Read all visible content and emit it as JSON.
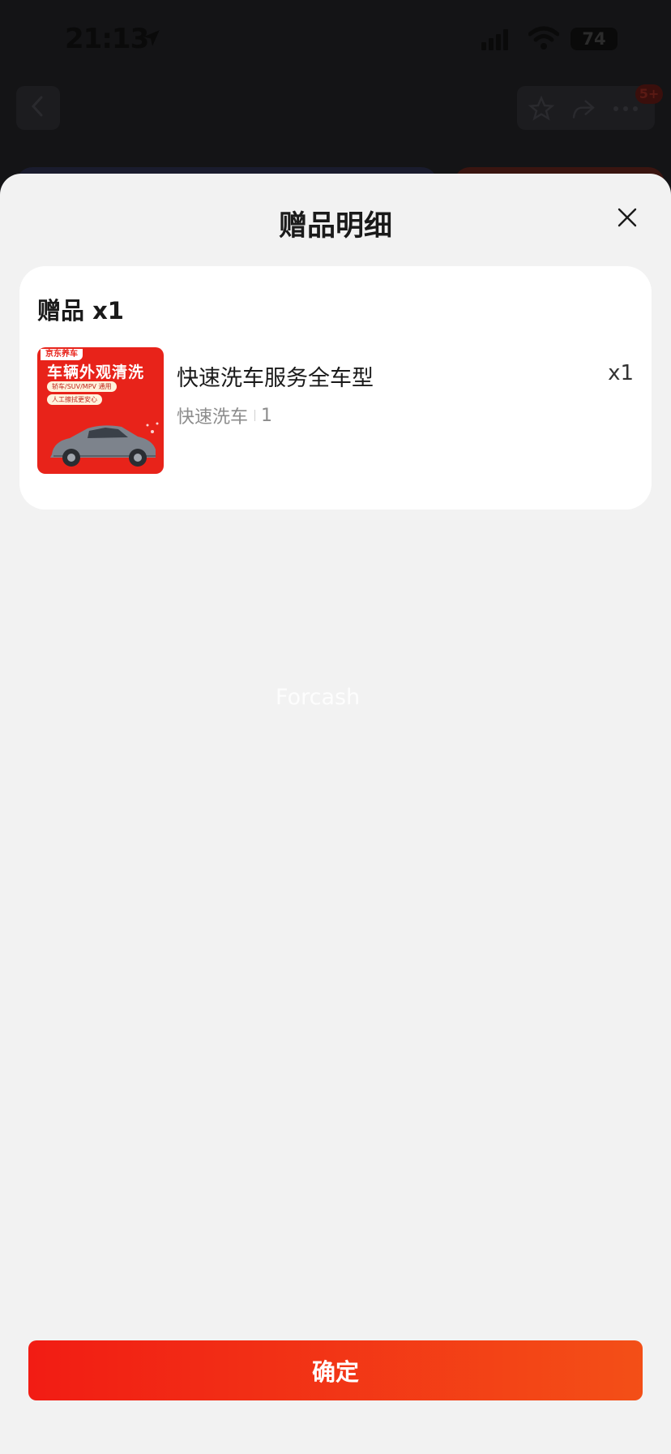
{
  "status_bar": {
    "time": "21:13",
    "battery": "74",
    "location_icon": "location-arrow-icon",
    "signal_icon": "cellular-signal-icon",
    "wifi_icon": "wifi-icon"
  },
  "background_nav": {
    "back_icon": "chevron-left-icon",
    "favorite_icon": "star-icon",
    "share_icon": "share-icon",
    "more_icon": "more-icon",
    "badge": "5+"
  },
  "sheet": {
    "title": "赠品明细",
    "close_icon": "close-icon",
    "gift_heading": "赠品 x1",
    "gift": {
      "name": "快速洗车服务全车型",
      "quantity": "x1",
      "spec_name": "快速洗车",
      "spec_count": "1",
      "image": {
        "brand": "京东养车",
        "headline": "车辆外观清洗",
        "tag1": "轿车/SUV/MPV 通用",
        "tag2": "人工擦拭更安心"
      }
    },
    "watermark": "Forcash",
    "confirm_label": "确定"
  },
  "colors": {
    "accent_start": "#f21c14",
    "accent_end": "#f34f17",
    "sheet_bg": "#f2f2f2",
    "card_bg": "#ffffff"
  }
}
